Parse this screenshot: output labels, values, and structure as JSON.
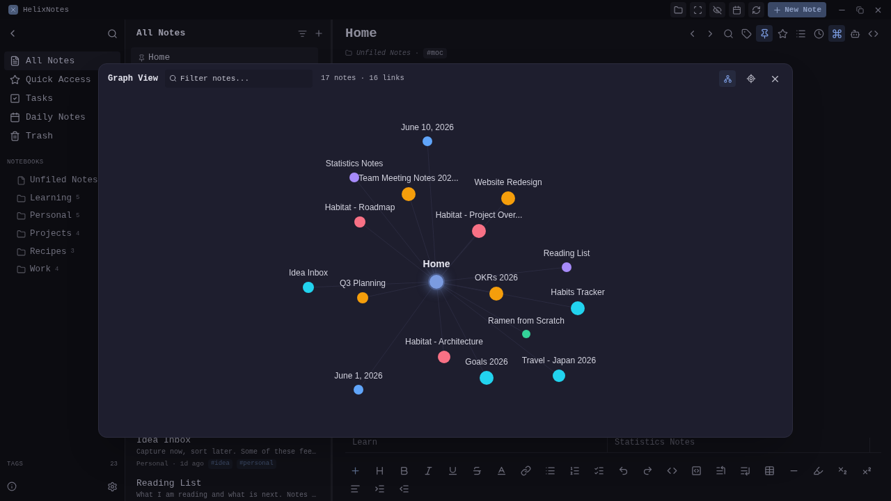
{
  "app": {
    "name": "HelixNotes",
    "new_note_button": "New Note"
  },
  "sidebar": {
    "items": [
      {
        "label": "All Notes",
        "selected": true
      },
      {
        "label": "Quick Access",
        "selected": false
      },
      {
        "label": "Tasks",
        "selected": false
      },
      {
        "label": "Daily Notes",
        "selected": false
      },
      {
        "label": "Trash",
        "selected": false
      }
    ],
    "notebooks_heading": "NOTEBOOKS",
    "notebooks": [
      {
        "label": "Unfiled Notes",
        "kind": "file"
      },
      {
        "label": "Learning",
        "count": "5",
        "kind": "folder"
      },
      {
        "label": "Personal",
        "count": "5",
        "kind": "folder"
      },
      {
        "label": "Projects",
        "count": "4",
        "kind": "folder"
      },
      {
        "label": "Recipes",
        "count": "3",
        "kind": "folder"
      },
      {
        "label": "Work",
        "count": "4",
        "kind": "folder"
      }
    ],
    "tags": {
      "label": "TAGS",
      "count": "23"
    }
  },
  "notes_list": {
    "title": "All Notes",
    "pinned": "Home",
    "notes": [
      {
        "title": "Idea Inbox",
        "excerpt": "Capture now, sort later. Some of these fee…",
        "meta": "Personal · 1d ago",
        "tags": [
          "#idea",
          "#personal"
        ]
      },
      {
        "title": "Reading List",
        "excerpt": "What I am reading and what is next. Notes …"
      }
    ]
  },
  "editor": {
    "title": "Home",
    "notebook": "Unfiled Notes",
    "separator": "·",
    "tag": "#moc",
    "table_cells": [
      "Learn",
      "Statistics Notes"
    ]
  },
  "graph": {
    "title": "Graph View",
    "filter_placeholder": "Filter notes...",
    "stats": "17 notes · 16 links",
    "nodes": [
      {
        "label": "June 10, 2026",
        "color": "#60a5fa",
        "selected": false
      },
      {
        "label": "Statistics Notes",
        "color": "#a78bfa",
        "selected": false
      },
      {
        "label": "Team Meeting Notes 202...",
        "color": "#f59e0b",
        "selected": false
      },
      {
        "label": "Website Redesign",
        "color": "#f59e0b",
        "selected": false
      },
      {
        "label": "Habitat - Roadmap",
        "color": "#f87185",
        "selected": false
      },
      {
        "label": "Habitat - Project Over...",
        "color": "#f87185",
        "selected": false
      },
      {
        "label": "Reading List",
        "color": "#a78bfa",
        "selected": false
      },
      {
        "label": "Home",
        "color": "#7b9be0",
        "selected": true
      },
      {
        "label": "Idea Inbox",
        "color": "#22d3ee",
        "selected": false
      },
      {
        "label": "Q3 Planning",
        "color": "#f59e0b",
        "selected": false
      },
      {
        "label": "OKRs 2026",
        "color": "#f59e0b",
        "selected": false
      },
      {
        "label": "Habits Tracker",
        "color": "#22d3ee",
        "selected": false
      },
      {
        "label": "Ramen from Scratch",
        "color": "#34d399",
        "selected": false
      },
      {
        "label": "Habitat - Architecture",
        "color": "#f87185",
        "selected": false
      },
      {
        "label": "Goals 2026",
        "color": "#22d3ee",
        "selected": false
      },
      {
        "label": "Travel - Japan 2026",
        "color": "#22d3ee",
        "selected": false
      },
      {
        "label": "June 1, 2026",
        "color": "#60a5fa",
        "selected": false
      }
    ]
  }
}
